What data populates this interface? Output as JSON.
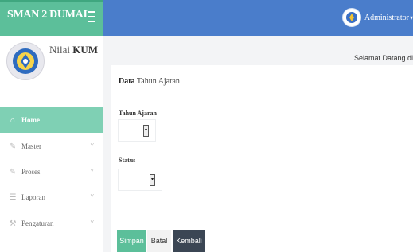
{
  "brand": {
    "title": "SMAN 2 DUMAI"
  },
  "user": {
    "name": "Administrator"
  },
  "sidebar": {
    "app_name_prefix": "Nilai",
    "app_name_bold": "KUM",
    "items": [
      {
        "label": "Home",
        "icon": "home-icon",
        "active": true
      },
      {
        "label": "Master",
        "icon": "pencil-icon",
        "chevron": "˅"
      },
      {
        "label": "Proses",
        "icon": "pencil-icon",
        "chevron": "˅"
      },
      {
        "label": "Laporan",
        "icon": "list-icon",
        "chevron": "˅"
      },
      {
        "label": "Pengaturan",
        "icon": "wrench-icon",
        "chevron": "˅"
      }
    ]
  },
  "main": {
    "welcome": "Selamat Datang di",
    "card_title_bold": "Data",
    "card_title_rest": "Tahun Ajaran",
    "fields": {
      "tahun_ajaran_label": "Tahun Ajaran",
      "status_label": "Status"
    },
    "buttons": {
      "save": "Simpan",
      "cancel": "Batal",
      "back": "Kembali"
    }
  },
  "colors": {
    "brand_green": "#5cbf9a",
    "topbar_blue": "#4a7dcb",
    "active_nav": "#7fd0b4",
    "back_button": "#3b4654"
  }
}
